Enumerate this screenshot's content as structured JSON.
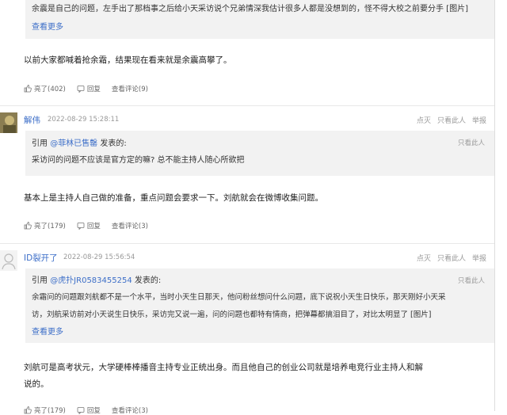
{
  "top_quote": {
    "text": "余震是自己的问题，左手出了那档事之后给小天采访说个兄弟情深我估计很多人都是没想到的，怪不得大校之前要分手 [图片]",
    "see_more": "查看更多"
  },
  "post1": {
    "text": "以前大家都喊着抢余霜，结果现在看来就是余震高攀了。",
    "actions": {
      "like": "亮了(402)",
      "reply": "回复",
      "view": "查看评论(9)"
    }
  },
  "post2": {
    "author": "解伟",
    "time": "2022-08-29 15:28:11",
    "ops": {
      "hide": "点灭",
      "only": "只看此人",
      "report": "举报"
    },
    "quote": {
      "cite_prefix": "引用",
      "cite_user": "@菲林已售罄",
      "cite_suffix": "发表的:",
      "only_him": "只看此人",
      "text": "采访问的问题不应该是官方定的嘛? 总不能主持人随心所欲把"
    },
    "text": "基本上是主持人自己做的准备，重点问题会要求一下。刘航就会在微博收集问题。",
    "actions": {
      "like": "亮了(179)",
      "reply": "回复",
      "view": "查看评论(3)"
    }
  },
  "post3": {
    "author": "ID裂开了",
    "time": "2022-08-29 15:56:54",
    "ops": {
      "hide": "点灭",
      "only": "只看此人",
      "report": "举报"
    },
    "quote": {
      "cite_prefix": "引用",
      "cite_user": "@虎扑JR0583455254",
      "cite_suffix": "发表的:",
      "only_him": "只看此人",
      "line1": "余霜问的问题跟刘航都不是一个水平，当时小天生日那天，他问粉丝想问什么问题，底下说祝小天生日快乐，那天刚好小天采",
      "line2": "访，刘航采访前对小天说生日快乐，采访完又说一遍，问的问题也都特有情商，把弹幕都搞泪目了，对比太明显了 [图片]",
      "see_more": "查看更多"
    },
    "text_line1": "刘航可是高考状元，大学硬棒棒播音主持专业正统出身。而且他自己的创业公司就是培养电竞行业主持人和解",
    "text_line2": "说的。",
    "actions": {
      "like": "亮了(179)",
      "reply": "回复",
      "view": "查看评论(3)"
    }
  },
  "colors": {
    "link": "#3c6ec8",
    "quote_bg": "#f2f2f2"
  }
}
